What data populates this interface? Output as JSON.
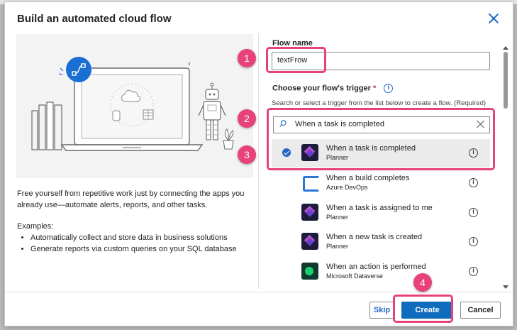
{
  "dialog": {
    "title": "Build an automated cloud flow",
    "description": "Free yourself from repetitive work just by connecting the apps you already use—automate alerts, reports, and other tasks.",
    "examples_label": "Examples:",
    "examples": [
      "Automatically collect and store data in business solutions",
      "Generate reports via custom queries on your SQL database"
    ]
  },
  "form": {
    "flow_name_label": "Flow name",
    "flow_name_value": "textFrow",
    "trigger_label": "Choose your flow's trigger",
    "required_mark": "*",
    "trigger_hint": "Search or select a trigger from the list below to create a flow. (Required)",
    "search_value": "When a task is completed"
  },
  "triggers": [
    {
      "name": "When a task is completed",
      "connector": "Planner",
      "icon": "planner-icon",
      "selected": true
    },
    {
      "name": "When a build completes",
      "connector": "Azure DevOps",
      "icon": "azure-devops-icon",
      "selected": false
    },
    {
      "name": "When a task is assigned to me",
      "connector": "Planner",
      "icon": "planner-icon",
      "selected": false
    },
    {
      "name": "When a new task is created",
      "connector": "Planner",
      "icon": "planner-icon",
      "selected": false
    },
    {
      "name": "When an action is performed",
      "connector": "Microsoft Dataverse",
      "icon": "dataverse-icon",
      "selected": false
    }
  ],
  "buttons": {
    "skip": "Skip",
    "create": "Create",
    "cancel": "Cancel"
  },
  "annotations": [
    "1",
    "2",
    "3",
    "4"
  ],
  "colors": {
    "accent": "#0f6cbd",
    "highlight": "#e8427a",
    "link": "#2266c4"
  }
}
